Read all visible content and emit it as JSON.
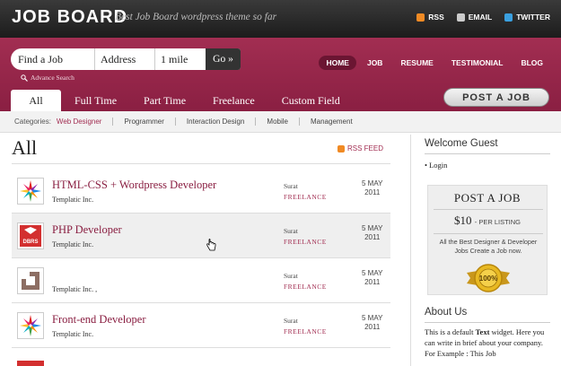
{
  "header": {
    "logo": "JOB BOARD",
    "tagline": "Best Job Board wordpress theme so far",
    "links": [
      {
        "label": "RSS",
        "icon": "rss-icon"
      },
      {
        "label": "EMAIL",
        "icon": "email-icon"
      },
      {
        "label": "TWITTER",
        "icon": "twitter-icon"
      }
    ]
  },
  "search": {
    "job": "Find a Job",
    "address": "Address",
    "distance": "1 mile",
    "go": "Go »",
    "advance": "Advance Search"
  },
  "nav": [
    "HOME",
    "JOB",
    "RESUME",
    "TESTIMONIAL",
    "BLOG"
  ],
  "tabs": [
    "All",
    "Full Time",
    "Part Time",
    "Freelance",
    "Custom Field"
  ],
  "post_button": "POST A JOB",
  "categories": {
    "label": "Categories:",
    "items": [
      "Web Designer",
      "Programmer",
      "Interaction Design",
      "Mobile",
      "Management"
    ]
  },
  "page": {
    "title": "All",
    "rss": "RSS FEED"
  },
  "jobs": [
    {
      "title": "HTML-CSS + Wordpress Developer",
      "company": "Templatic Inc.",
      "location": "Surat",
      "type": "FREELANCE",
      "date_day": "5 MAY",
      "date_year": "2011",
      "thumb": "star-logo-icon"
    },
    {
      "title": "PHP Developer",
      "company": "Templatic Inc.",
      "location": "Surat",
      "type": "FREELANCE",
      "date_day": "5 MAY",
      "date_year": "2011",
      "thumb": "dbrs-logo-icon"
    },
    {
      "title": "",
      "company": "Templatic Inc. ,",
      "location": "Surat",
      "type": "FREELANCE",
      "date_day": "5 MAY",
      "date_year": "2011",
      "thumb": "d-logo-icon"
    },
    {
      "title": "Front-end Developer",
      "company": "Templatic Inc.",
      "location": "Surat",
      "type": "FREELANCE",
      "date_day": "5 MAY",
      "date_year": "2011",
      "thumb": "star-logo-icon"
    }
  ],
  "sidebar": {
    "welcome": "Welcome Guest",
    "login": "Login",
    "postbox": {
      "title": "POST A JOB",
      "price": "$10",
      "per": "- PER LISTING",
      "desc": "All the Best Designer & Developer Jobs Create a Job now.",
      "badge": "100%"
    },
    "about_title": "About Us",
    "about_pre": "This is a default ",
    "about_bold": "Text",
    "about_post": " widget. Here you can write in brief about your company. For Example : This Job"
  },
  "colors": {
    "accent": "#a22e52",
    "dark": "#222222"
  }
}
